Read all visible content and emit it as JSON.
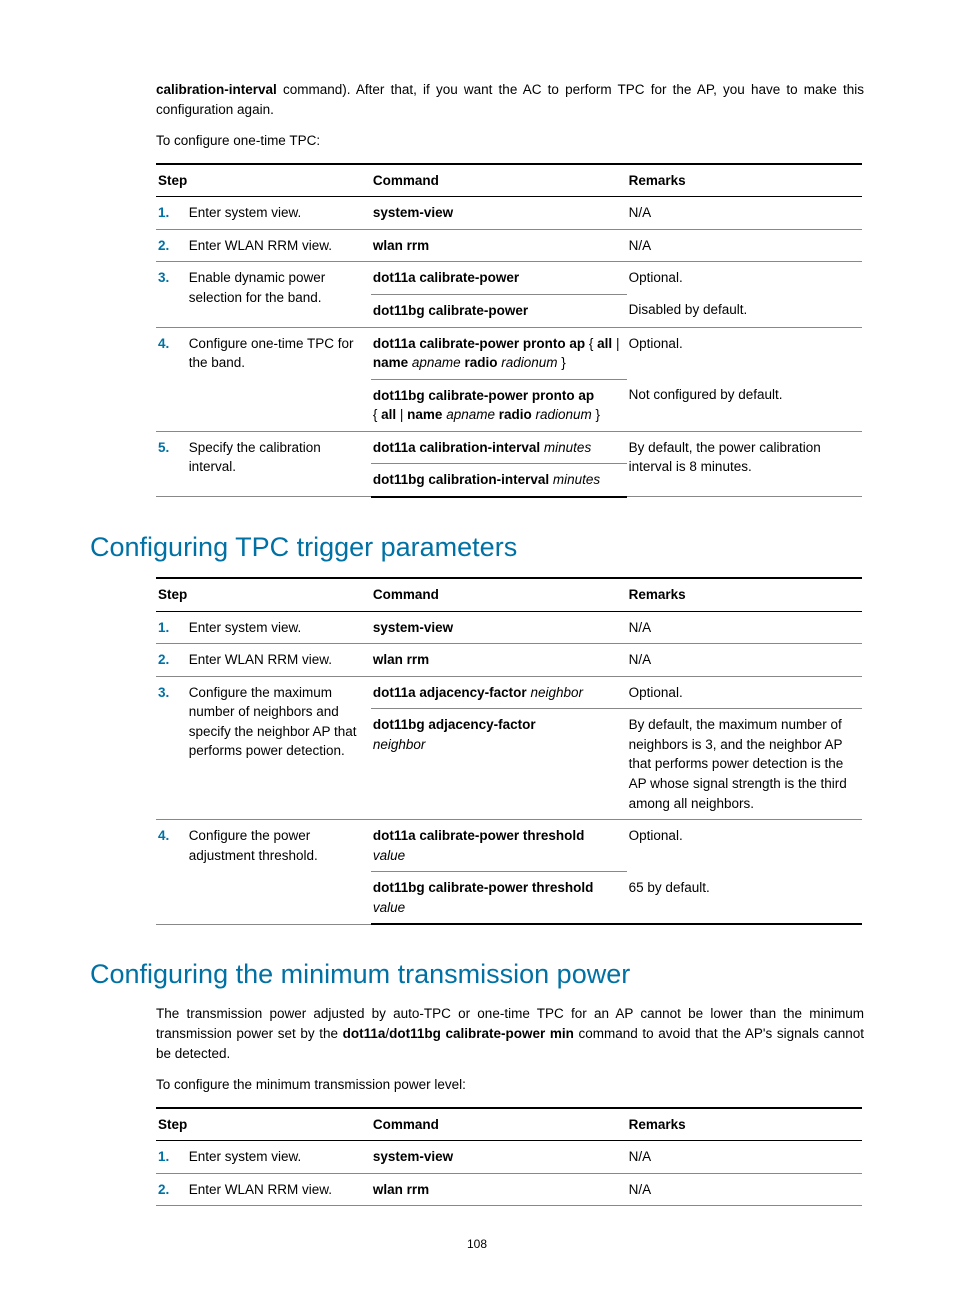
{
  "intro_paragraph": {
    "bold_lead": "calibration-interval",
    "rest": " command). After that, if you want the AC to perform TPC for the AP, you have to make this configuration again."
  },
  "lead_in_1": "To configure one-time TPC:",
  "table_headers": {
    "step": "Step",
    "command": "Command",
    "remarks": "Remarks"
  },
  "table1": {
    "r1": {
      "n": "1.",
      "step": "Enter system view.",
      "cmd_b": "system-view",
      "rem": "N/A"
    },
    "r2": {
      "n": "2.",
      "step": "Enter WLAN RRM view.",
      "cmd_b": "wlan rrm",
      "rem": "N/A"
    },
    "r3": {
      "n": "3.",
      "step": "Enable dynamic power selection for the band.",
      "cmd_a_b": "dot11a calibrate-power",
      "cmd_b_b": "dot11bg calibrate-power",
      "rem_a": "Optional.",
      "rem_b": "Disabled by default."
    },
    "r4": {
      "n": "4.",
      "step": "Configure one-time TPC for the band.",
      "cmd_a_b1": "dot11a calibrate-power pronto ap",
      "cmd_a_t1": " { ",
      "cmd_a_b2": "all",
      "cmd_a_t2": " | ",
      "cmd_a_b3": "name",
      "cmd_a_i1": " apname ",
      "cmd_a_b4": "radio",
      "cmd_a_i2": " radionum",
      "cmd_a_t3": " }",
      "cmd_b_b1": "dot11bg calibrate-power pronto ap",
      "cmd_b_t1": " { ",
      "cmd_b_b2": "all",
      "cmd_b_t2": " | ",
      "cmd_b_b3": "name",
      "cmd_b_i1": " apname ",
      "cmd_b_b4": "radio",
      "cmd_b_i2": " radionum",
      "cmd_b_t3": " }",
      "rem_a": "Optional.",
      "rem_b": "Not configured by default."
    },
    "r5": {
      "n": "5.",
      "step": "Specify the calibration interval.",
      "cmd_a_b": "dot11a calibration-interval",
      "cmd_a_i": " minutes",
      "cmd_b_b": "dot11bg calibration-interval",
      "cmd_b_i": " minutes",
      "rem": "By default, the power calibration interval is 8 minutes."
    }
  },
  "heading2": "Configuring TPC trigger parameters",
  "table2": {
    "r1": {
      "n": "1.",
      "step": "Enter system view.",
      "cmd_b": "system-view",
      "rem": "N/A"
    },
    "r2": {
      "n": "2.",
      "step": "Enter WLAN RRM view.",
      "cmd_b": "wlan rrm",
      "rem": "N/A"
    },
    "r3": {
      "n": "3.",
      "step": "Configure the maximum number of neighbors and specify the neighbor AP that performs power detection.",
      "cmd_a_b": "dot11a adjacency-factor",
      "cmd_a_i": " neighbor",
      "cmd_b_b": "dot11bg adjacency-factor",
      "cmd_b_i": "neighbor",
      "rem_a": "Optional.",
      "rem_b": "By default, the maximum number of neighbors is 3, and the neighbor AP that performs power detection is the AP whose signal strength is the third among all neighbors."
    },
    "r4": {
      "n": "4.",
      "step": "Configure the power adjustment threshold.",
      "cmd_a_b": "dot11a calibrate-power threshold",
      "cmd_a_i": "value",
      "cmd_b_b": "dot11bg calibrate-power threshold",
      "cmd_b_i": " value",
      "rem_a": "Optional.",
      "rem_b": "65 by default."
    }
  },
  "heading3": "Configuring the minimum transmission power",
  "para3_a": "The transmission power adjusted by auto-TPC or one-time TPC for an AP cannot be lower than the minimum transmission power set by the ",
  "para3_b": "dot11a",
  "para3_slash": "/",
  "para3_c": "dot11bg calibrate-power min",
  "para3_d": " command to avoid that the AP's signals cannot be detected.",
  "lead_in_3": "To configure the minimum transmission power level:",
  "table3": {
    "r1": {
      "n": "1.",
      "step": "Enter system view.",
      "cmd_b": "system-view",
      "rem": "N/A"
    },
    "r2": {
      "n": "2.",
      "step": "Enter WLAN RRM view.",
      "cmd_b": "wlan rrm",
      "rem": "N/A"
    }
  },
  "page_number": "108"
}
